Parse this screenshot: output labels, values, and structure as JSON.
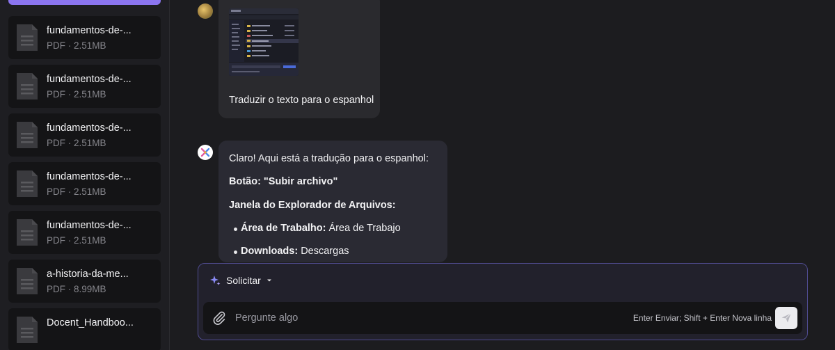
{
  "sidebar": {
    "files": [
      {
        "name": "fundamentos-de-...",
        "meta": "PDF · 2.51MB"
      },
      {
        "name": "fundamentos-de-...",
        "meta": "PDF · 2.51MB"
      },
      {
        "name": "fundamentos-de-...",
        "meta": "PDF · 2.51MB"
      },
      {
        "name": "fundamentos-de-...",
        "meta": "PDF · 2.51MB"
      },
      {
        "name": "fundamentos-de-...",
        "meta": "PDF · 2.51MB"
      },
      {
        "name": "a-historia-da-me...",
        "meta": "PDF · 8.99MB"
      },
      {
        "name": "Docent_Handboo...",
        "meta": ""
      }
    ]
  },
  "chat": {
    "user_message": "Traduzir o texto para o espanhol",
    "ai_response": {
      "intro": "Claro! Aqui está a tradução para o espanhol:",
      "button_line": "Botão: \"Subir archivo\"",
      "window_heading": "Janela do Explorador de Arquivos:",
      "items": [
        {
          "label": "Área de Trabalho:",
          "value": " Área de Trabajo"
        },
        {
          "label": "Downloads:",
          "value": " Descargas"
        }
      ]
    }
  },
  "composer": {
    "mode_label": "Solicitar",
    "placeholder": "Pergunte algo",
    "hint": "Enter Enviar; Shift + Enter Nova linha"
  },
  "icons": {
    "file": "document-icon",
    "sparkle": "sparkle-icon",
    "attach": "paperclip-icon",
    "send": "send-icon"
  },
  "colors": {
    "accent": "#8b75f0",
    "composer_border": "#4f4b8f",
    "sidebar_card": "#141416"
  }
}
